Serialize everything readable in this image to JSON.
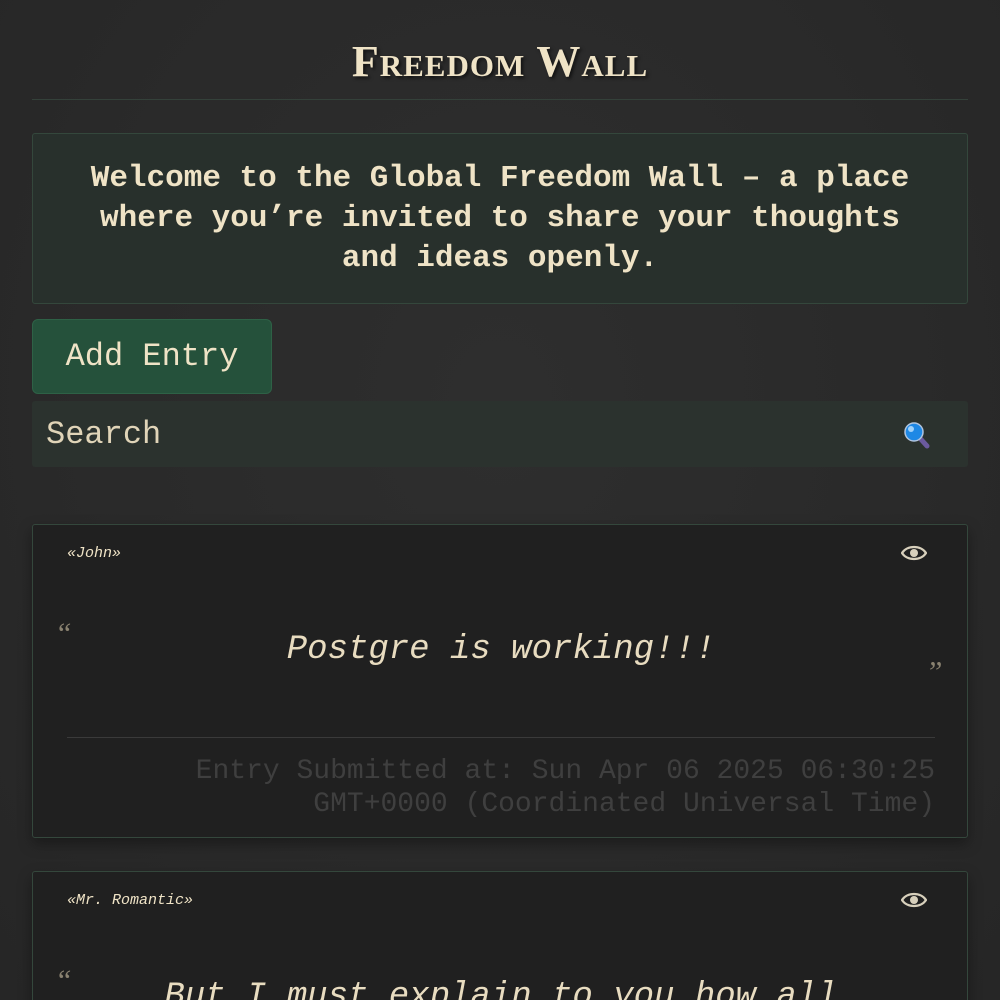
{
  "header": {
    "title": "Freedom Wall"
  },
  "welcome": {
    "text": "Welcome to the Global Freedom Wall – a place where you’re invited to share your thoughts and ideas openly."
  },
  "actions": {
    "add_entry_label": "Add Entry"
  },
  "search": {
    "placeholder": "Search",
    "icon": "magnifying-glass-icon"
  },
  "entries": [
    {
      "author": "«John»",
      "quote_open": "“",
      "text": "Postgre is working!!!",
      "quote_close": "„",
      "timestamp": "Entry Submitted at: Sun Apr 06 2025 06:30:25 GMT+0000 (Coordinated Universal Time)",
      "view_icon": "eye-icon"
    },
    {
      "author": "«Mr. Romantic»",
      "quote_open": "“",
      "text": "But I must explain to you how all",
      "view_icon": "eye-icon"
    }
  ],
  "colors": {
    "background": "#2a2a2a",
    "accent_green": "#25513b",
    "text_cream": "#efe3c6",
    "card_border": "#34473c"
  }
}
